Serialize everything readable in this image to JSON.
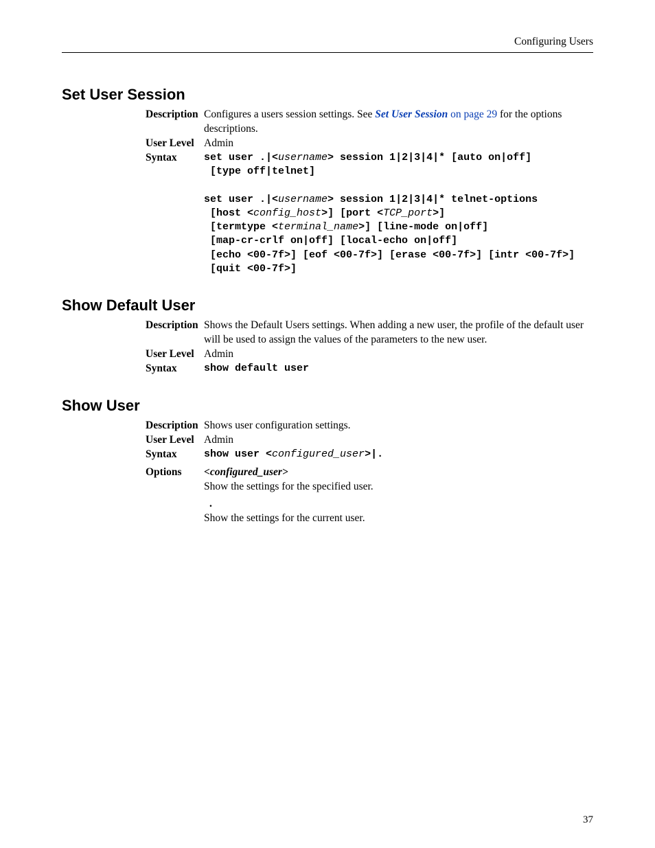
{
  "header": "Configuring Users",
  "page_number": "37",
  "sections": {
    "set_user_session": {
      "title": "Set User Session",
      "desc_label": "Description",
      "desc_pre": "Configures a users session settings. See ",
      "desc_link_italic": "Set User Session",
      "desc_link_tail": " on page 29",
      "desc_post": " for the options descriptions.",
      "ul_label": "User Level",
      "ul_value": "Admin",
      "syntax_label": "Syntax"
    },
    "show_default_user": {
      "title": "Show Default User",
      "desc_label": "Description",
      "desc_text": "Shows the Default Users settings. When adding a new user, the profile of the default user will be used to assign the values of the parameters to the new user.",
      "ul_label": "User Level",
      "ul_value": "Admin",
      "syntax_label": "Syntax",
      "syntax_code": "show default user"
    },
    "show_user": {
      "title": "Show User",
      "desc_label": "Description",
      "desc_text": "Shows user configuration settings.",
      "ul_label": "User Level",
      "ul_value": "Admin",
      "syntax_label": "Syntax",
      "options_label": "Options",
      "opt1_name": "<configured_user>",
      "opt1_text": "Show the settings for the specified user.",
      "opt2_name": ".",
      "opt2_text": "Show the settings for the current user."
    }
  }
}
